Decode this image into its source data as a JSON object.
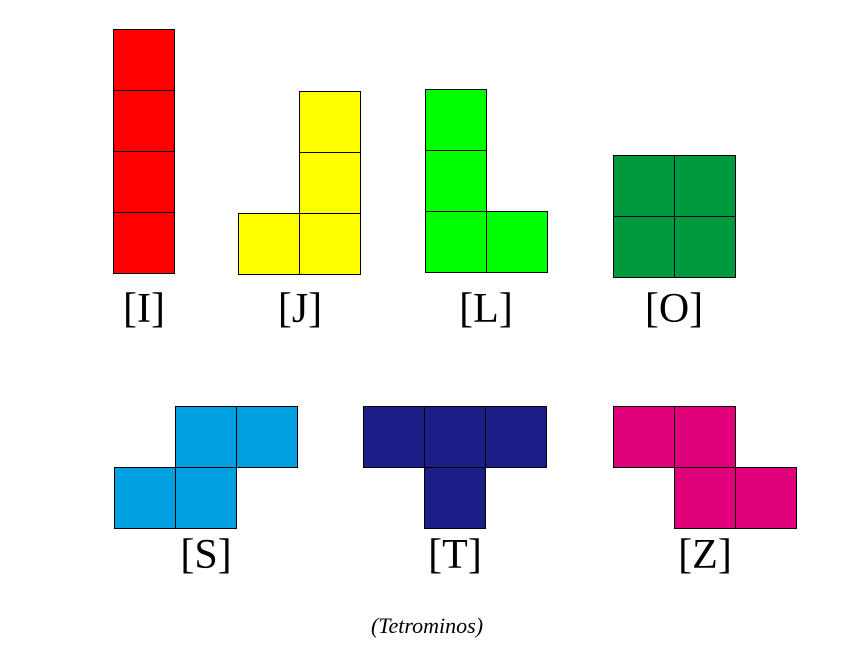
{
  "caption": "(Tetrominos)",
  "pieces": [
    {
      "id": "i",
      "label": "[I]",
      "color": "#ff0000",
      "cells": [
        [
          0,
          0
        ],
        [
          0,
          1
        ],
        [
          0,
          2
        ],
        [
          0,
          3
        ]
      ]
    },
    {
      "id": "j",
      "label": "[J]",
      "color": "#ffff00",
      "cells": [
        [
          1,
          0
        ],
        [
          1,
          1
        ],
        [
          0,
          2
        ],
        [
          1,
          2
        ]
      ]
    },
    {
      "id": "l",
      "label": "[L]",
      "color": "#00ff00",
      "cells": [
        [
          0,
          0
        ],
        [
          0,
          1
        ],
        [
          0,
          2
        ],
        [
          1,
          2
        ]
      ]
    },
    {
      "id": "o",
      "label": "[O]",
      "color": "#009a3e",
      "cells": [
        [
          0,
          0
        ],
        [
          1,
          0
        ],
        [
          0,
          1
        ],
        [
          1,
          1
        ]
      ]
    },
    {
      "id": "s",
      "label": "[S]",
      "color": "#00a0e0",
      "cells": [
        [
          1,
          0
        ],
        [
          2,
          0
        ],
        [
          0,
          1
        ],
        [
          1,
          1
        ]
      ]
    },
    {
      "id": "t",
      "label": "[T]",
      "color": "#1b1e87",
      "cells": [
        [
          0,
          0
        ],
        [
          1,
          0
        ],
        [
          2,
          0
        ],
        [
          1,
          1
        ]
      ]
    },
    {
      "id": "z",
      "label": "[Z]",
      "color": "#e0007a",
      "cells": [
        [
          0,
          0
        ],
        [
          1,
          0
        ],
        [
          1,
          1
        ],
        [
          2,
          1
        ]
      ]
    }
  ]
}
